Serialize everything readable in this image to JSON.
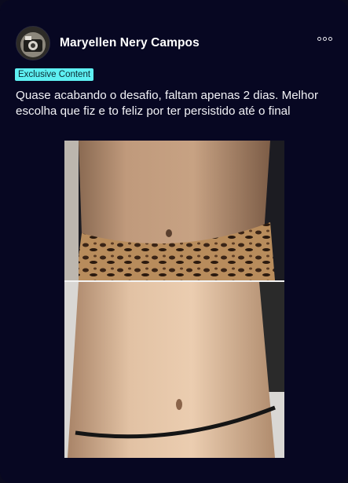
{
  "post": {
    "author_name": "Maryellen Nery Campos",
    "badge": "Exclusive Content",
    "caption": "Quase acabando o desafio, faltam apenas 2 dias. Melhor escolha que fiz e to feliz por ter persistido até o final",
    "menu_icon": "more-options-icon",
    "image_alt": "Before and after torso comparison photo"
  },
  "colors": {
    "background": "#070722",
    "badge_bg": "#5ef0f2",
    "text": "#f2f2f6"
  }
}
